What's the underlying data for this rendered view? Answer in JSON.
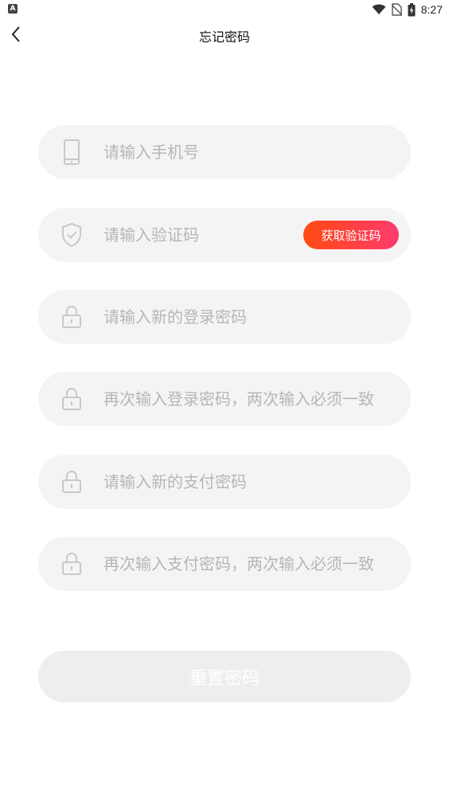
{
  "status_bar": {
    "left_icon": "A",
    "time": "8:27",
    "icons": [
      "wifi-icon",
      "no-sim-icon",
      "battery-charging-icon"
    ]
  },
  "nav": {
    "title": "忘记密码",
    "back_icon": "chevron-left-icon"
  },
  "form": {
    "phone": {
      "placeholder": "请输入手机号",
      "icon": "phone-icon"
    },
    "code": {
      "placeholder": "请输入验证码",
      "icon": "shield-check-icon",
      "button_label": "获取验证码"
    },
    "new_login_password": {
      "placeholder": "请输入新的登录密码",
      "icon": "lock-icon"
    },
    "confirm_login_password": {
      "placeholder": "再次输入登录密码，两次输入必须一致",
      "icon": "lock-icon"
    },
    "new_pay_password": {
      "placeholder": "请输入新的支付密码",
      "icon": "lock-icon"
    },
    "confirm_pay_password": {
      "placeholder": "再次输入支付密码，两次输入必须一致",
      "icon": "lock-icon"
    }
  },
  "submit": {
    "label": "重置密码"
  },
  "colors": {
    "field_bg": "#f4f4f4",
    "placeholder": "#b6b6b6",
    "icon": "#c8c8c8",
    "accent_start": "#ff4a12",
    "accent_end": "#ff3a6e",
    "submit_bg": "#eeeeee"
  }
}
